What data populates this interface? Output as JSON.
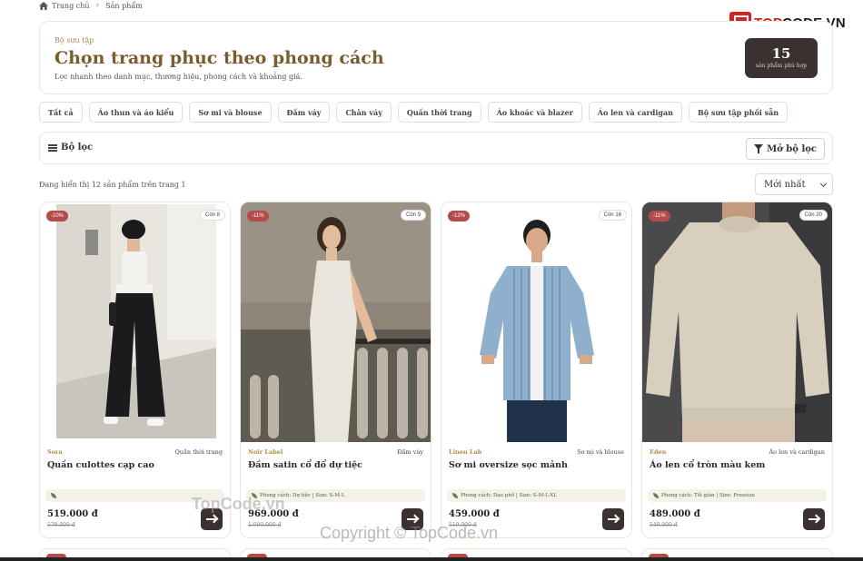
{
  "breadcrumb": {
    "home": "Trang chủ",
    "current": "Sản phẩm"
  },
  "logo": {
    "text_a": "TOP",
    "text_b": "CODE.VN"
  },
  "hero": {
    "kicker": "Bộ sưu tập",
    "title": "Chọn trang phục theo phong cách",
    "subtitle": "Lọc nhanh theo danh mục, thương hiệu, phong cách và khoảng giá.",
    "count": "15",
    "count_label": "sản phẩm phù hợp"
  },
  "chips": [
    "Tất cả",
    "Áo thun và áo kiểu",
    "Sơ mi và blouse",
    "Đầm váy",
    "Chân váy",
    "Quần thời trang",
    "Áo khoác và blazer",
    "Áo len và cardigan",
    "Bộ sưu tập phối sẵn"
  ],
  "filter": {
    "label": "Bộ lọc",
    "open_label": "Mở bộ lọc"
  },
  "listing": {
    "showing": "Đang hiển thị 12 sản phẩm trên trang 1",
    "sort": "Mới nhất"
  },
  "products": [
    {
      "discount": "-10%",
      "stock": "Còn 8",
      "brand": "Sora",
      "category": "Quần thời trang",
      "name": "Quần culottes cạp cao",
      "meta": "",
      "price": "519.000 đ",
      "old_price": "579.000 đ"
    },
    {
      "discount": "-11%",
      "stock": "Còn 9",
      "brand": "Noir Label",
      "category": "Đầm váy",
      "name": "Đầm satin cổ đổ dự tiệc",
      "meta": "Phong cách: Dự tiệc | Size: S-M-L",
      "price": "969.000 đ",
      "old_price": "1.090.000 đ"
    },
    {
      "discount": "-12%",
      "stock": "Còn 16",
      "brand": "Linen Lab",
      "category": "Sơ mi và blouse",
      "name": "Sơ mi oversize sọc mảnh",
      "meta": "Phong cách: Dạo phố | Size: S-M-L-XL",
      "price": "459.000 đ",
      "old_price": "519.000 đ"
    },
    {
      "discount": "-11%",
      "stock": "Còn 20",
      "brand": "Eden",
      "category": "Áo len và cardigan",
      "name": "Áo len cổ tròn màu kem",
      "meta": "Phong cách: Tối giản | Size: Freesize",
      "price": "489.000 đ",
      "old_price": "549.000 đ"
    }
  ],
  "watermarks": {
    "a": "TopCode.vn",
    "b": "Copyright © TopCode.vn"
  },
  "colors": {
    "accent_gold": "#7a5c2e",
    "dark": "#3a3130",
    "discount": "#b44a4a"
  }
}
